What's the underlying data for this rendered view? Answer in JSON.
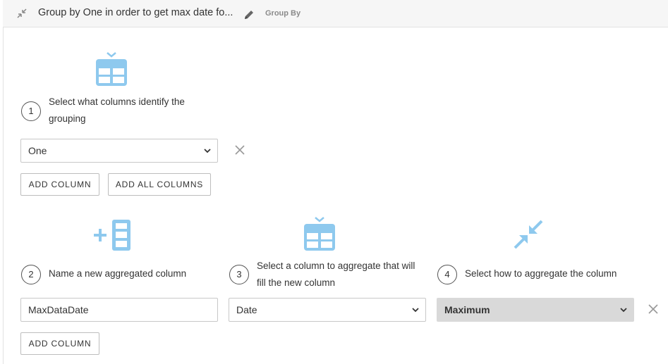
{
  "header": {
    "title": "Group by One in order to get max date fo...",
    "subtitle": "Group By"
  },
  "step1": {
    "number": "1",
    "text_line1": "Select what columns identify the",
    "text_line2": "grouping",
    "group_select_value": "One",
    "add_column_label": "ADD COLUMN",
    "add_all_columns_label": "ADD ALL COLUMNS"
  },
  "step2": {
    "number": "2",
    "text": "Name a new aggregated column",
    "input_value": "MaxDataDate",
    "add_column_label": "ADD COLUMN"
  },
  "step3": {
    "number": "3",
    "text_line1": "Select a column to aggregate that will",
    "text_line2": "fill the new column",
    "select_value": "Date"
  },
  "step4": {
    "number": "4",
    "text": "Select how to aggregate the column",
    "select_value": "Maximum"
  },
  "colors": {
    "icon_blue": "#8ec9ee",
    "header_bg": "#f6f6f6",
    "disabled_bg": "#d9d9d9"
  },
  "icons": [
    "collapse-icon",
    "pencil-icon",
    "table-select-icon",
    "add-column-icon",
    "table-select-icon",
    "compress-arrows-icon",
    "close-icon",
    "chevron-down-icon"
  ]
}
